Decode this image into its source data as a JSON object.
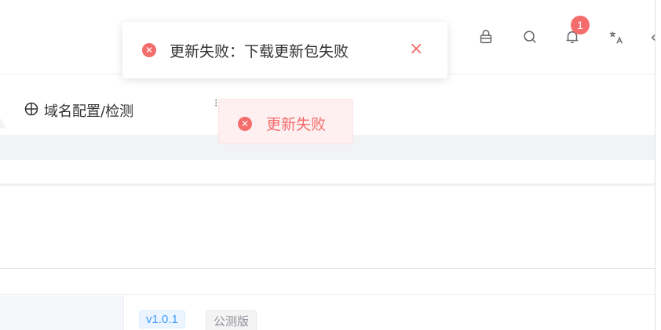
{
  "header": {
    "icons": [
      "lock-icon",
      "search-icon",
      "bell-icon",
      "translate-icon",
      "theme-icon"
    ],
    "notification_count": "1"
  },
  "toast_main": {
    "message": "更新失败：下载更新包失败",
    "close_label": "×"
  },
  "toast_small": {
    "message": "更新失败"
  },
  "tab": {
    "label": "域名配置/检测",
    "more": "⁝"
  },
  "version": {
    "number": "v1.0.1",
    "channel": "公测版"
  },
  "colors": {
    "error": "#f56c6c",
    "primary": "#409eff",
    "info": "#909399"
  }
}
